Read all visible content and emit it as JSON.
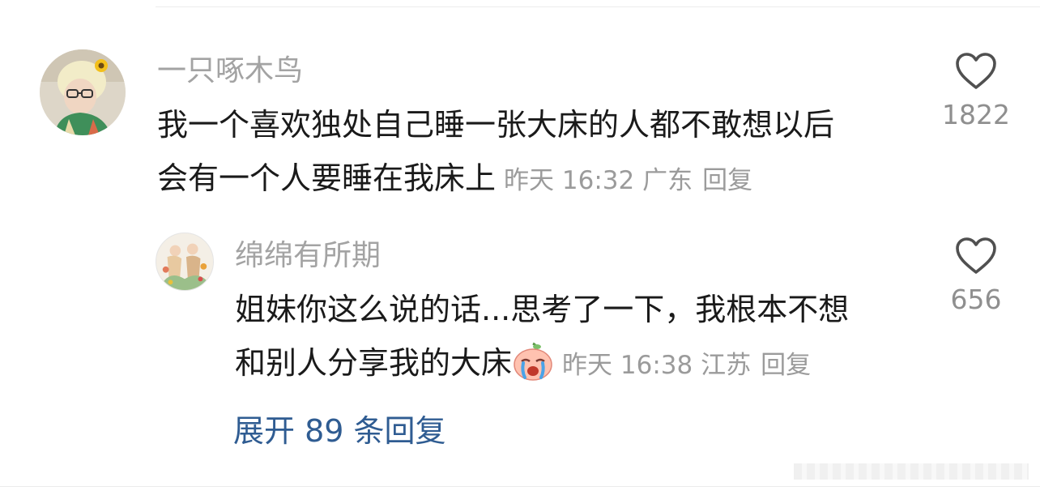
{
  "main_comment": {
    "username": "一只啄木鸟",
    "text_line1": "我一个喜欢独处自己睡一张大床的人都不敢想以后",
    "text_line2": "会有一个人要睡在我床上",
    "time": "昨天 16:32",
    "location": "广东",
    "reply_label": "回复",
    "like_count": "1822",
    "avatar_icon": "user-avatar-sunflower",
    "like_icon": "heart-outline-icon"
  },
  "reply_comment": {
    "username": "绵绵有所期",
    "text_line1": "姐妹你这么说的话...思考了一下，我根本不想",
    "text_line2": "和别人分享我的大床",
    "emoji": "crying-peach-emoji",
    "time": "昨天 16:38",
    "location": "江苏",
    "reply_label": "回复",
    "like_count": "656",
    "avatar_icon": "user-avatar-illustration",
    "like_icon": "heart-outline-icon"
  },
  "expand_replies": {
    "label": "展开 89 条回复"
  },
  "colors": {
    "username": "#a3a3a3",
    "body": "#1a1a1a",
    "meta": "#9b9b9b",
    "link": "#2f5c92"
  }
}
